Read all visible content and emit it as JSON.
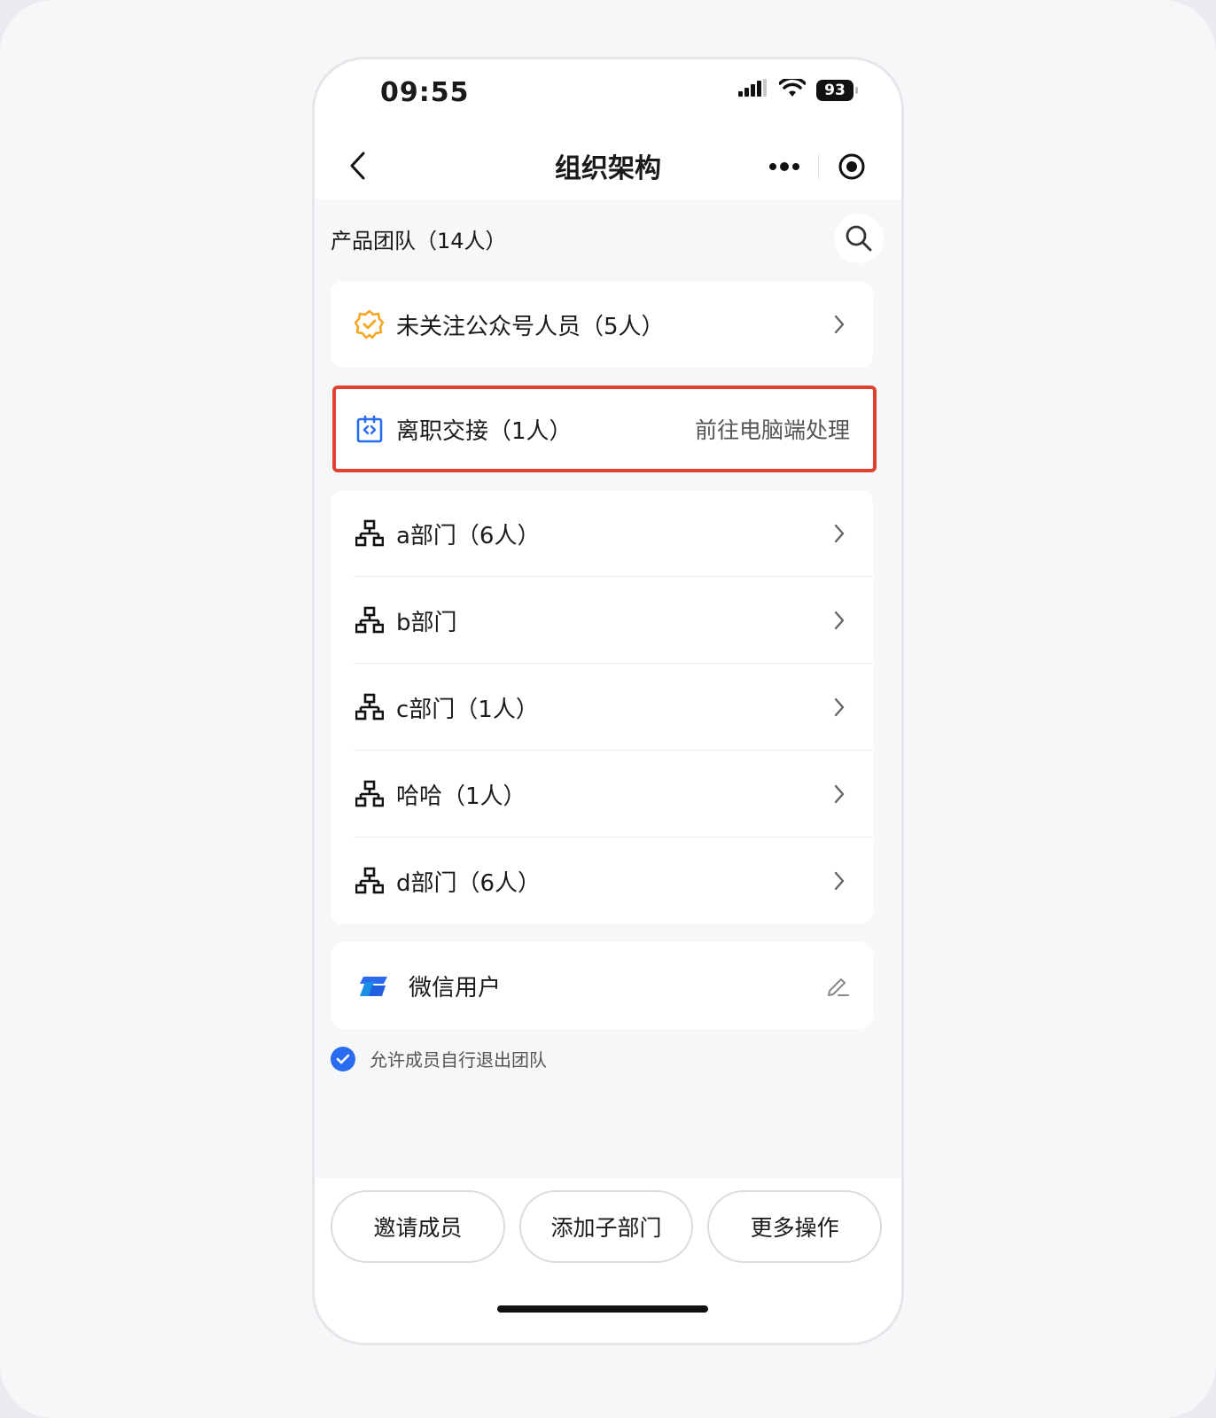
{
  "status": {
    "time": "09:55",
    "battery": "93"
  },
  "nav": {
    "title": "组织架构"
  },
  "team": {
    "title": "产品团队（14人）"
  },
  "unfollowed": {
    "label": "未关注公众号人员（5人）",
    "icon": "badge-check-icon",
    "icon_color": "#f5a623"
  },
  "handover": {
    "label": "离职交接（1人）",
    "action": "前往电脑端处理",
    "icon": "transfer-icon",
    "icon_color": "#2a6cf0"
  },
  "departments": [
    {
      "label": "a部门（6人）"
    },
    {
      "label": "b部门"
    },
    {
      "label": "c部门（1人）"
    },
    {
      "label": "哈哈（1人）"
    },
    {
      "label": "d部门（6人）"
    }
  ],
  "wechat": {
    "label": "微信用户",
    "icon": "wechat-work-logo-icon"
  },
  "permission": {
    "label": "允许成员自行退出团队",
    "checked": true
  },
  "buttons": {
    "invite": "邀请成员",
    "add_sub_dept": "添加子部门",
    "more": "更多操作"
  },
  "colors": {
    "accent": "#2a6cf0",
    "highlight": "#e0402e",
    "warning": "#f5a623"
  }
}
